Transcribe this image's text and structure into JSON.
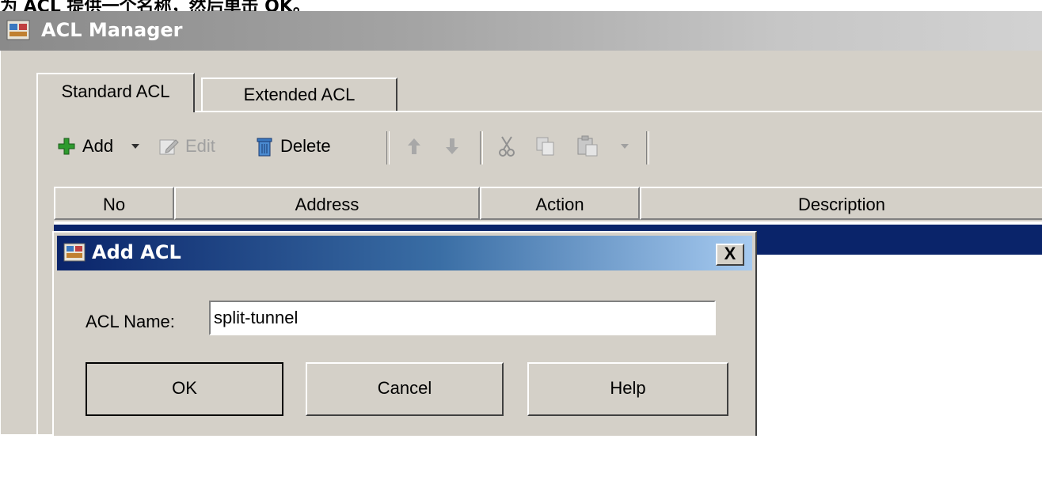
{
  "caption": "为 ACL 提供一个名称，然后单击 OK。",
  "window": {
    "title": "ACL Manager"
  },
  "tabs": [
    {
      "label": "Standard ACL",
      "active": true
    },
    {
      "label": "Extended ACL",
      "active": false
    }
  ],
  "toolbar": {
    "add_label": "Add",
    "edit_label": "Edit",
    "delete_label": "Delete"
  },
  "table": {
    "columns": [
      "No",
      "Address",
      "Action",
      "Description"
    ]
  },
  "dialog": {
    "title": "Add ACL",
    "close_label": "X",
    "field_label": "ACL Name:",
    "field_value": "split-tunnel",
    "buttons": {
      "ok": "OK",
      "cancel": "Cancel",
      "help": "Help"
    }
  },
  "colors": {
    "selection": "#0a246a",
    "dialog_title_start": "#0a246a",
    "dialog_title_end": "#a6caf0",
    "window_face": "#d4d0c8"
  }
}
